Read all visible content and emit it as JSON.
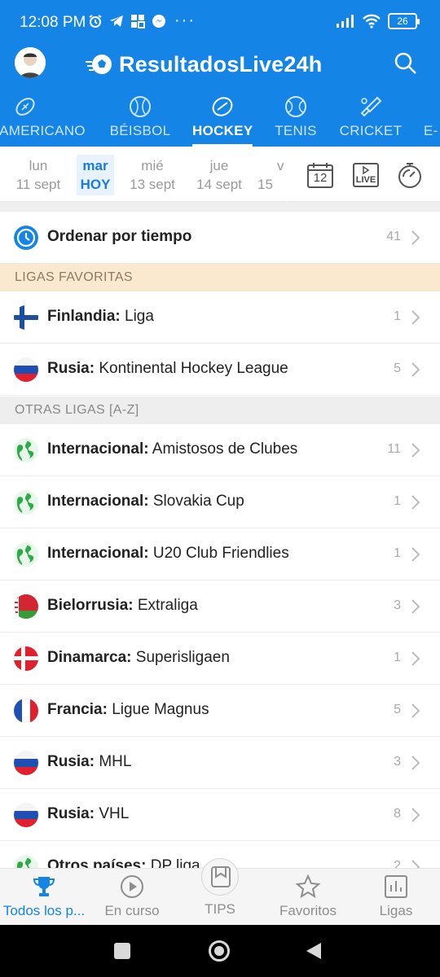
{
  "status": {
    "time": "12:08 PM",
    "dots": "···",
    "battery": "26"
  },
  "app": {
    "brand": "ResultadosLive24h"
  },
  "sports": [
    {
      "label": "AMERICANO",
      "icon": "football-icon",
      "active": false
    },
    {
      "label": "BÉISBOL",
      "icon": "baseball-icon",
      "active": false
    },
    {
      "label": "HOCKEY",
      "icon": "hockey-puck-icon",
      "active": true
    },
    {
      "label": "TENIS",
      "icon": "tennis-ball-icon",
      "active": false
    },
    {
      "label": "CRICKET",
      "icon": "cricket-icon",
      "active": false
    },
    {
      "label": "E-",
      "icon": "esports-icon",
      "active": false
    }
  ],
  "dates": [
    {
      "day": "lun",
      "date": "11 sept"
    },
    {
      "day": "mar",
      "date": "HOY",
      "active": true
    },
    {
      "day": "mié",
      "date": "13 sept"
    },
    {
      "day": "jue",
      "date": "14 sept"
    },
    {
      "day": "v",
      "date": "15"
    }
  ],
  "tools": {
    "calendar_day": "12",
    "live_label": "LIVE"
  },
  "sort": {
    "label": "Ordenar por tiempo",
    "count": "41"
  },
  "sections": {
    "favorites": "LIGAS FAVORITAS",
    "others": "OTRAS LIGAS [A-Z]"
  },
  "favorites": [
    {
      "country": "Finlandia:",
      "league": " Liga",
      "count": "1",
      "flag": "finland"
    },
    {
      "country": "Rusia:",
      "league": " Kontinental Hockey League",
      "count": "5",
      "flag": "russia"
    }
  ],
  "others": [
    {
      "country": "Internacional:",
      "league": " Amistosos de Clubes",
      "count": "11",
      "flag": "world"
    },
    {
      "country": "Internacional:",
      "league": " Slovakia Cup",
      "count": "1",
      "flag": "world"
    },
    {
      "country": "Internacional:",
      "league": " U20 Club Friendlies",
      "count": "1",
      "flag": "world"
    },
    {
      "country": "Bielorrusia:",
      "league": " Extraliga",
      "count": "3",
      "flag": "belarus"
    },
    {
      "country": "Dinamarca:",
      "league": " Superisligaen",
      "count": "1",
      "flag": "denmark"
    },
    {
      "country": "Francia:",
      "league": " Ligue Magnus",
      "count": "5",
      "flag": "france"
    },
    {
      "country": "Rusia:",
      "league": " MHL",
      "count": "3",
      "flag": "russia"
    },
    {
      "country": "Rusia:",
      "league": " VHL",
      "count": "8",
      "flag": "russia"
    },
    {
      "country": "Otros países:",
      "league": " DP liga",
      "count": "2",
      "flag": "world"
    }
  ],
  "bottom_nav": [
    {
      "label": "Todos los p...",
      "icon": "trophy-icon",
      "active": true
    },
    {
      "label": "En curso",
      "icon": "play-circle-icon",
      "active": false
    },
    {
      "label": "TIPS",
      "icon": "tips-icon",
      "active": false
    },
    {
      "label": "Favoritos",
      "icon": "star-icon",
      "active": false
    },
    {
      "label": "Ligas",
      "icon": "chart-icon",
      "active": false
    }
  ],
  "colors": {
    "primary": "#1484e6",
    "favorites_bg": "#fbe9cf",
    "section_bg": "#eeeeee"
  }
}
